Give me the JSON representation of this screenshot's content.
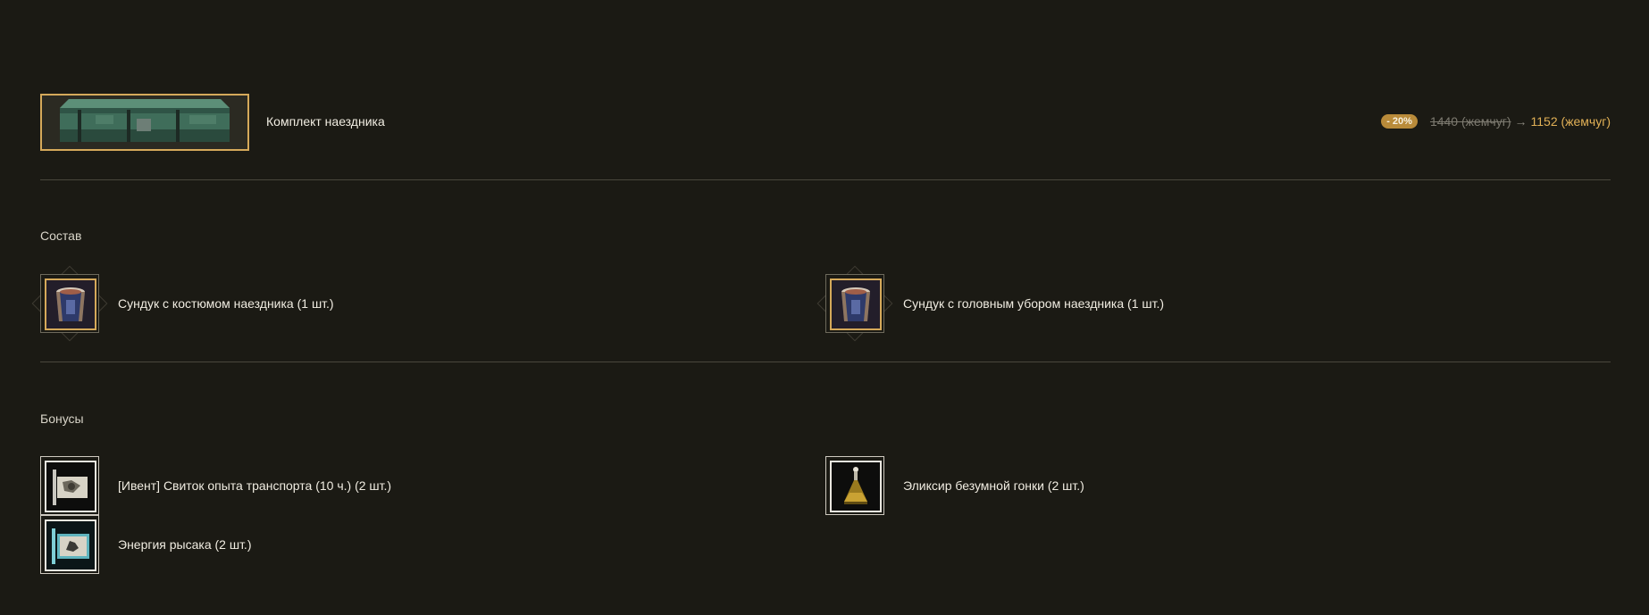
{
  "product": {
    "title": "Комплект наездника",
    "image_icon": "green-chest-icon",
    "discount": "- 20%",
    "old_price": "1440 (жемчуг)",
    "arrow": "→",
    "new_price": "1152 (жемчуг)"
  },
  "composition": {
    "title": "Состав",
    "items": [
      {
        "label": "Сундук с костюмом наездника (1 шт.)",
        "icon": "costume-chest-icon"
      },
      {
        "label": "Сундук с головным убором наездника (1 шт.)",
        "icon": "headgear-chest-icon"
      }
    ]
  },
  "bonuses": {
    "title": "Бонусы",
    "items": [
      {
        "label": "[Ивент] Свиток опыта транспорта (10 ч.) (2 шт.)",
        "icon": "mount-exp-scroll-icon"
      },
      {
        "label": "Эликсир безумной гонки (2 шт.)",
        "icon": "elixir-flask-icon"
      },
      {
        "label": "Энергия рысака (2 шт.)",
        "icon": "horse-energy-scroll-icon"
      }
    ]
  },
  "colors": {
    "background": "#1b1a14",
    "accent_gold": "#d5a95a",
    "price_gold": "#e1b056",
    "divider": "#4a473d"
  }
}
